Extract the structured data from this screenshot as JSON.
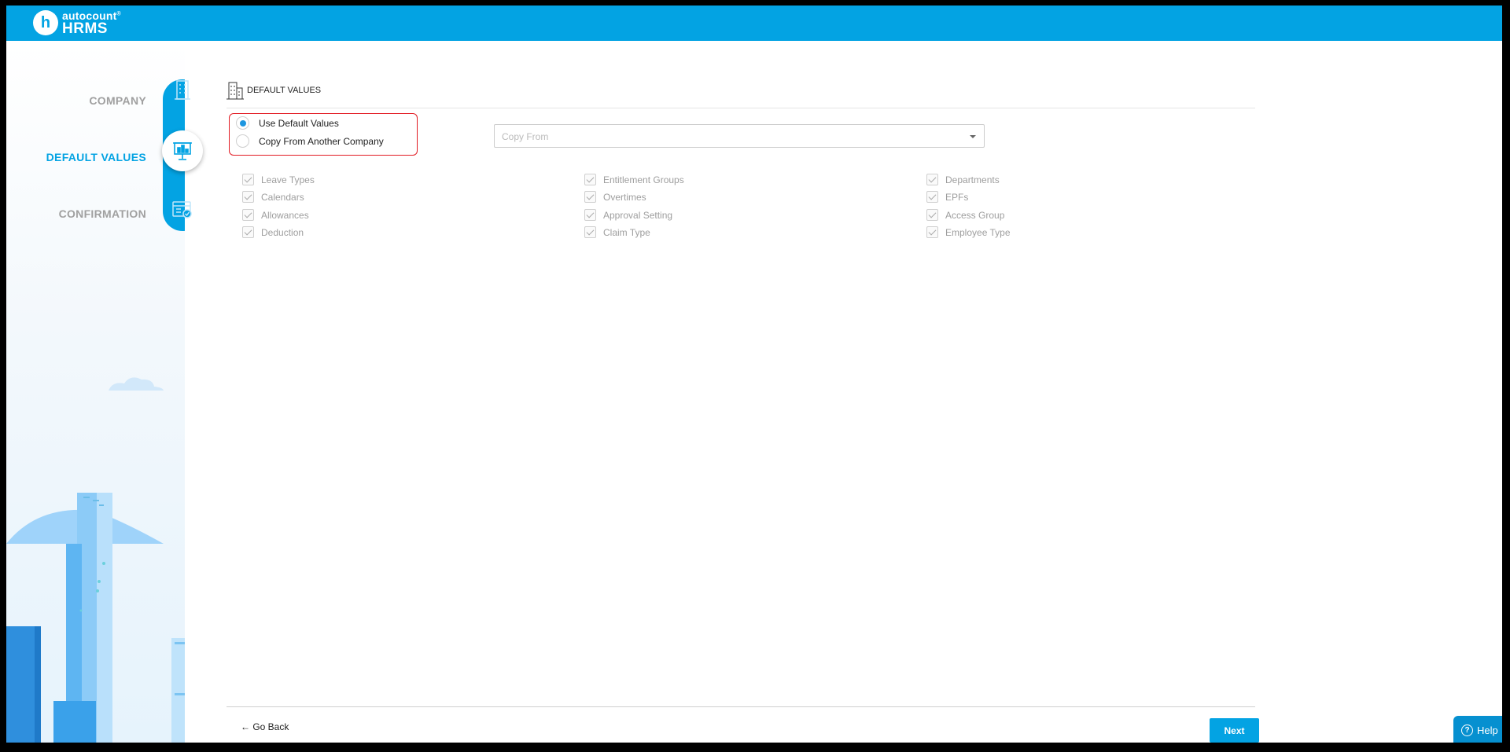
{
  "app": {
    "logo_top": "autocount",
    "logo_reg": "®",
    "logo_bottom": "HRMS",
    "logo_badge": "h"
  },
  "sidebar": {
    "steps": [
      {
        "label": "COMPANY",
        "icon": "building-icon",
        "state": "done"
      },
      {
        "label": "DEFAULT VALUES",
        "icon": "presentation-board-icon",
        "state": "active"
      },
      {
        "label": "CONFIRMATION",
        "icon": "checklist-card-icon",
        "state": "pending"
      }
    ]
  },
  "section": {
    "title": "DEFAULT VALUES",
    "icon": "building-icon"
  },
  "source": {
    "options": [
      {
        "label": "Use Default Values",
        "checked": true
      },
      {
        "label": "Copy From Another Company",
        "checked": false
      }
    ],
    "copy_from_placeholder": "Copy From"
  },
  "items": {
    "col1": [
      "Leave Types",
      "Calendars",
      "Allowances",
      "Deduction"
    ],
    "col2": [
      "Entitlement Groups",
      "Overtimes",
      "Approval Setting",
      "Claim Type"
    ],
    "col3": [
      "Departments",
      "EPFs",
      "Access Group",
      "Employee Type"
    ]
  },
  "footer": {
    "go_back": "← Go Back",
    "next": "Next",
    "help": "Help"
  },
  "colors": {
    "brand": "#03a3e3",
    "highlight": "#e21b23",
    "radio": "#1d96e0"
  }
}
